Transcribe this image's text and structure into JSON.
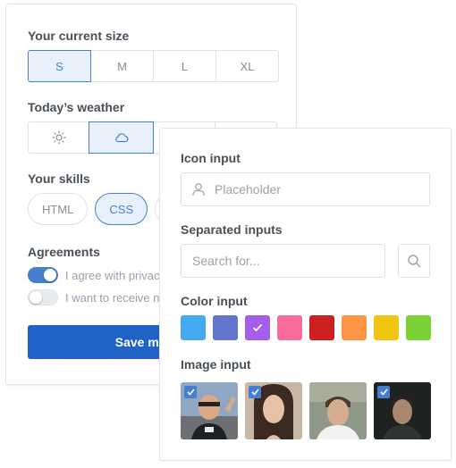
{
  "size": {
    "label": "Your current size",
    "options": [
      "S",
      "M",
      "L",
      "XL"
    ],
    "selected": "S"
  },
  "weather": {
    "label": "Today’s weather",
    "options": [
      "sun-icon",
      "cloud-icon"
    ],
    "selected": "cloud-icon"
  },
  "skills": {
    "label": "Your skills",
    "options": [
      "HTML",
      "CSS"
    ],
    "selected": "CSS"
  },
  "agreements": {
    "label": "Agreements",
    "items": [
      {
        "text": "I agree with privac",
        "on": true
      },
      {
        "text": "I want to receive n",
        "on": false
      }
    ]
  },
  "save_button": "Save my pre",
  "icon_input": {
    "label": "Icon input",
    "placeholder": "Placeholder",
    "icon": "user-icon"
  },
  "separated_inputs": {
    "label": "Separated inputs",
    "placeholder": "Search for...",
    "icon": "search-icon"
  },
  "color_input": {
    "label": "Color input",
    "colors": [
      "#45aaf2",
      "#6574cd",
      "#a55eea",
      "#f66d9b",
      "#cd201f",
      "#fd9644",
      "#f1c40f",
      "#7bd235"
    ],
    "selected_index": 2
  },
  "image_input": {
    "label": "Image input",
    "images": [
      {
        "checked": true
      },
      {
        "checked": true
      },
      {
        "checked": false
      },
      {
        "checked": true
      }
    ]
  },
  "theme": {
    "accent": "#467fcf",
    "primary_button": "#1f63c6"
  }
}
